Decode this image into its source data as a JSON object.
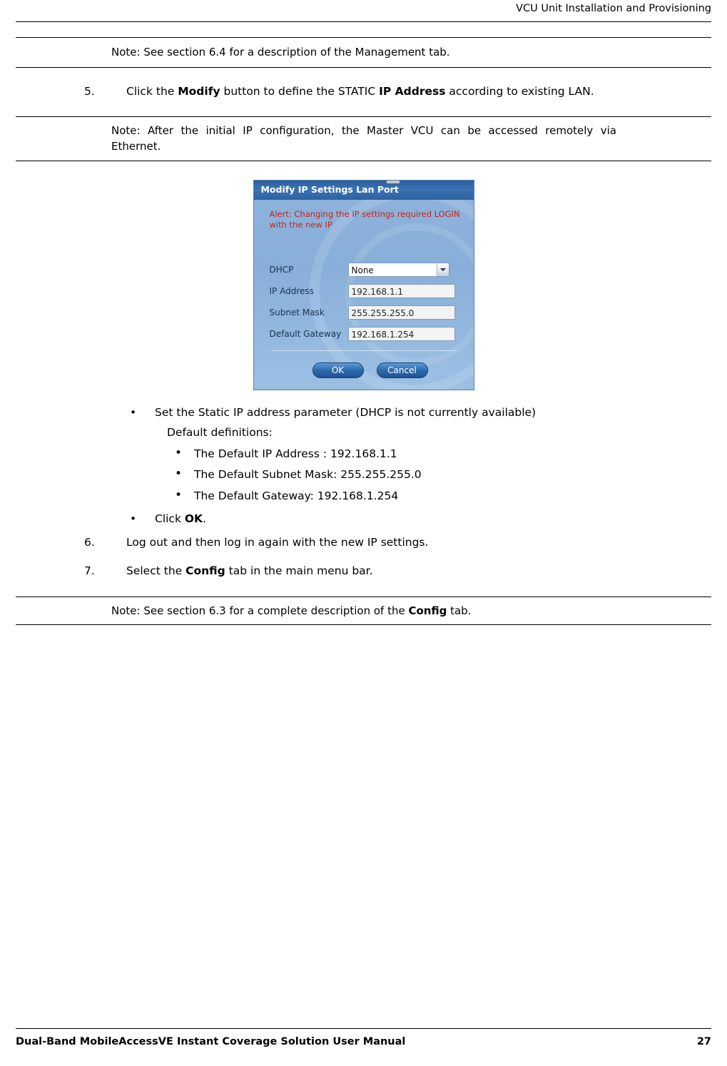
{
  "header": {
    "title": "VCU Unit Installation and Provisioning"
  },
  "footer": {
    "left": "Dual-Band MobileAccessVE Instant Coverage Solution User Manual",
    "page": "27"
  },
  "body": {
    "note1": "Note: See section 6.4 for a description of the Management tab.",
    "step5": {
      "number": "5.",
      "part1": "Click the ",
      "bold1": "Modify",
      "part2": " button to define the STATIC ",
      "bold2": "IP Address",
      "part3": " according to existing LAN."
    },
    "note2": "Note: After the initial IP configuration, the Master VCU can be accessed remotely via Ethernet.",
    "bullet_set_static": "Set the Static IP address parameter (DHCP is not currently available)",
    "default_definitions": "Default definitions:",
    "defaults": [
      "The Default IP Address : 192.168.1.1",
      "The Default Subnet Mask: 255.255.255.0",
      "The Default Gateway: 192.168.1.254"
    ],
    "bullet_click": {
      "text": "Click ",
      "bold": "OK",
      "tail": "."
    },
    "step6": {
      "number": "6.",
      "text": "Log out and then log in again with the new IP settings."
    },
    "step7": {
      "number": "7.",
      "part1": "Select the ",
      "bold1": "Config",
      "part2": " tab in the main menu bar."
    },
    "note3": {
      "part1": "Note: See section 6.3 for a complete description of the ",
      "bold1": "Config",
      "part2": " tab."
    }
  },
  "dialog": {
    "title": "Modify IP Settings Lan Port",
    "alert": "Alert: Changing the IP settings required LOGIN with the new IP",
    "fields": [
      {
        "label": "DHCP",
        "value": "None",
        "type": "select"
      },
      {
        "label": "IP Address",
        "value": "192.168.1.1",
        "type": "text"
      },
      {
        "label": "Subnet Mask",
        "value": "255.255.255.0",
        "type": "text"
      },
      {
        "label": "Default Gateway",
        "value": "192.168.1.254",
        "type": "text"
      }
    ],
    "ok_label": "OK",
    "cancel_label": "Cancel"
  }
}
